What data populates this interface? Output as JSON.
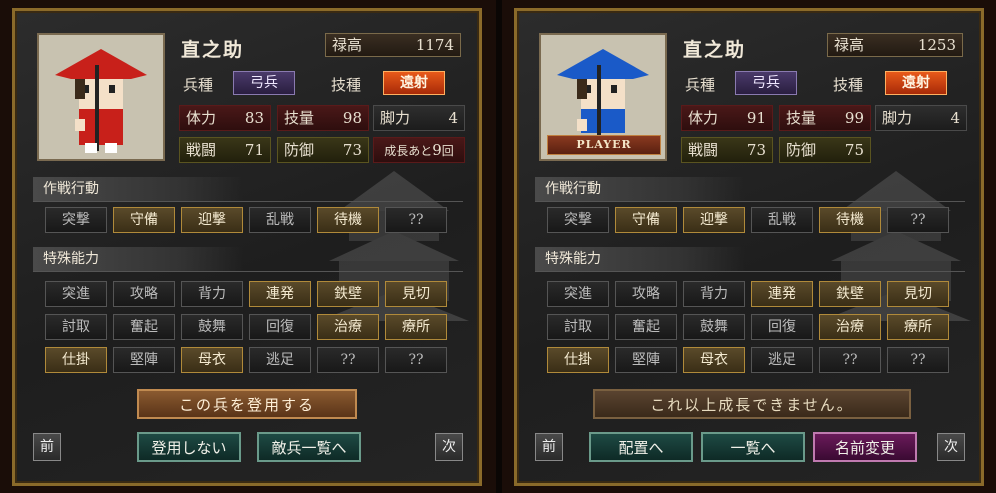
{
  "colors": {
    "panel_border": "#8a6a2a",
    "active_button": "#5a4a2a",
    "skill_orange": "#e85a1a",
    "unit_type_purple": "#4a3a6a",
    "hat_red": "#c8201a",
    "hat_blue": "#1a5ac8"
  },
  "left": {
    "name": "直之助",
    "stipend": {
      "label": "禄高",
      "value": "1174"
    },
    "unit_type": {
      "label": "兵種",
      "value": "弓兵"
    },
    "skill": {
      "label": "技種",
      "value": "遠射"
    },
    "stats": [
      {
        "label": "体力",
        "value": "83"
      },
      {
        "label": "技量",
        "value": "98"
      },
      {
        "label": "脚力",
        "value": "4"
      },
      {
        "label": "戦闘",
        "value": "71"
      },
      {
        "label": "防御",
        "value": "73"
      }
    ],
    "growth": {
      "prefix": "成長",
      "mid": "あと",
      "count": "9",
      "suffix": "回"
    },
    "tactics_title": "作戦行動",
    "tactics": [
      {
        "label": "突撃",
        "on": false
      },
      {
        "label": "守備",
        "on": true
      },
      {
        "label": "迎撃",
        "on": true
      },
      {
        "label": "乱戦",
        "on": false
      },
      {
        "label": "待機",
        "on": true
      },
      {
        "label": "??",
        "on": false
      }
    ],
    "abilities_title": "特殊能力",
    "abilities": [
      {
        "label": "突進",
        "on": false
      },
      {
        "label": "攻略",
        "on": false
      },
      {
        "label": "背力",
        "on": false
      },
      {
        "label": "連発",
        "on": true
      },
      {
        "label": "鉄壁",
        "on": true
      },
      {
        "label": "見切",
        "on": true
      },
      {
        "label": "討取",
        "on": false
      },
      {
        "label": "奮起",
        "on": false
      },
      {
        "label": "鼓舞",
        "on": false
      },
      {
        "label": "回復",
        "on": false
      },
      {
        "label": "治療",
        "on": true
      },
      {
        "label": "療所",
        "on": true
      },
      {
        "label": "仕掛",
        "on": true
      },
      {
        "label": "堅陣",
        "on": false
      },
      {
        "label": "母衣",
        "on": true
      },
      {
        "label": "逃足",
        "on": false
      },
      {
        "label": "??",
        "on": false
      },
      {
        "label": "??",
        "on": false
      }
    ],
    "recruit_label": "この兵を登用する",
    "prev_label": "前",
    "next_label": "次",
    "decline_label": "登用しない",
    "enemy_list_label": "敵兵一覧へ",
    "hat_color": "#c8201a"
  },
  "right": {
    "name": "直之助",
    "player_tag": "PLAYER",
    "stipend": {
      "label": "禄高",
      "value": "1253"
    },
    "unit_type": {
      "label": "兵種",
      "value": "弓兵"
    },
    "skill": {
      "label": "技種",
      "value": "遠射"
    },
    "stats": [
      {
        "label": "体力",
        "value": "91"
      },
      {
        "label": "技量",
        "value": "99"
      },
      {
        "label": "脚力",
        "value": "4"
      },
      {
        "label": "戦闘",
        "value": "73"
      },
      {
        "label": "防御",
        "value": "75"
      }
    ],
    "tactics_title": "作戦行動",
    "tactics": [
      {
        "label": "突撃",
        "on": false
      },
      {
        "label": "守備",
        "on": true
      },
      {
        "label": "迎撃",
        "on": true
      },
      {
        "label": "乱戦",
        "on": false
      },
      {
        "label": "待機",
        "on": true
      },
      {
        "label": "??",
        "on": false
      }
    ],
    "abilities_title": "特殊能力",
    "abilities": [
      {
        "label": "突進",
        "on": false
      },
      {
        "label": "攻略",
        "on": false
      },
      {
        "label": "背力",
        "on": false
      },
      {
        "label": "連発",
        "on": true
      },
      {
        "label": "鉄壁",
        "on": true
      },
      {
        "label": "見切",
        "on": true
      },
      {
        "label": "討取",
        "on": false
      },
      {
        "label": "奮起",
        "on": false
      },
      {
        "label": "鼓舞",
        "on": false
      },
      {
        "label": "回復",
        "on": false
      },
      {
        "label": "治療",
        "on": true
      },
      {
        "label": "療所",
        "on": true
      },
      {
        "label": "仕掛",
        "on": true
      },
      {
        "label": "堅陣",
        "on": false
      },
      {
        "label": "母衣",
        "on": true
      },
      {
        "label": "逃足",
        "on": false
      },
      {
        "label": "??",
        "on": false
      },
      {
        "label": "??",
        "on": false
      }
    ],
    "max_growth_label": "これ以上成長できません。",
    "prev_label": "前",
    "next_label": "次",
    "deploy_label": "配置へ",
    "list_label": "一覧へ",
    "rename_label": "名前変更",
    "hat_color": "#1a5ac8"
  }
}
